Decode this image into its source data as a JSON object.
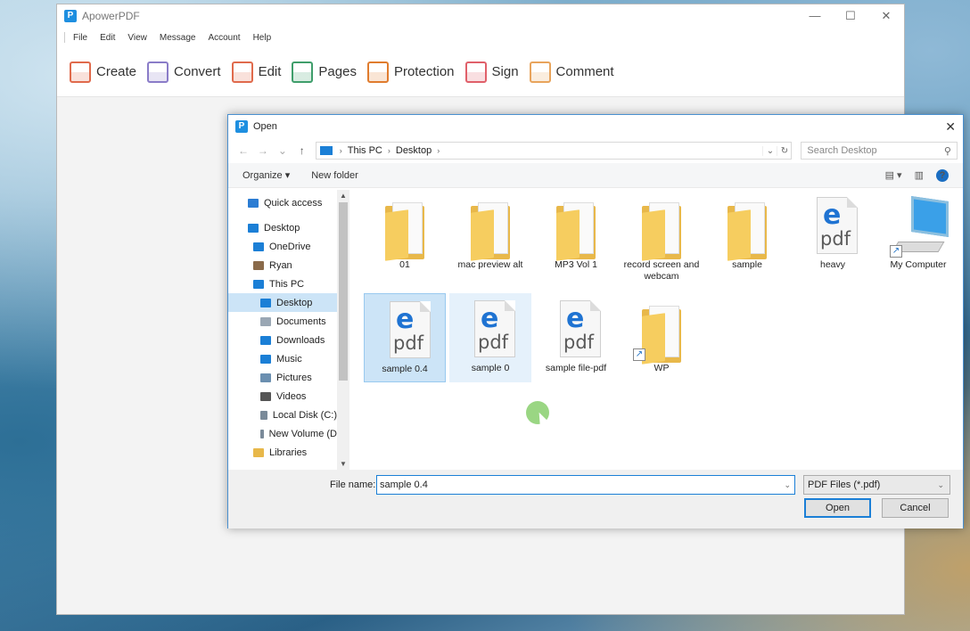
{
  "app": {
    "title": "ApowerPDF",
    "logo": "P",
    "window_controls": {
      "minimize": "—",
      "maximize": "☐",
      "close": "✕"
    },
    "menu": [
      "File",
      "Edit",
      "View",
      "Message",
      "Account",
      "Help"
    ],
    "toolbar": [
      {
        "label": "Create",
        "icon": "create-icon",
        "color": "#e06a4c"
      },
      {
        "label": "Convert",
        "icon": "convert-icon",
        "color": "#8a7cc8"
      },
      {
        "label": "Edit",
        "icon": "edit-icon",
        "color": "#e06a4c"
      },
      {
        "label": "Pages",
        "icon": "pages-icon",
        "color": "#3f9e6b"
      },
      {
        "label": "Protection",
        "icon": "shield-icon",
        "color": "#e07c2e"
      },
      {
        "label": "Sign",
        "icon": "pen-icon",
        "color": "#e0606a"
      },
      {
        "label": "Comment",
        "icon": "comment-icon",
        "color": "#e8a45c"
      }
    ]
  },
  "dialog": {
    "title": "Open",
    "close": "✕",
    "nav": {
      "back": "←",
      "forward": "→",
      "recent": "⌄",
      "up": "↑"
    },
    "breadcrumb": [
      "This PC",
      "Desktop"
    ],
    "search_placeholder": "Search Desktop",
    "organize": "Organize ▾",
    "new_folder": "New folder",
    "help": "?",
    "nav_pane": [
      {
        "label": "Quick access",
        "icon": "star-icon",
        "color": "#2b7cd3",
        "indent": 1
      },
      {
        "label": "Desktop",
        "icon": "desktop-icon",
        "color": "#1b7fd6",
        "indent": 1
      },
      {
        "label": "OneDrive",
        "icon": "cloud-icon",
        "color": "#1b7fd6",
        "indent": 2
      },
      {
        "label": "Ryan",
        "icon": "user-icon",
        "color": "#8a6a4a",
        "indent": 2
      },
      {
        "label": "This PC",
        "icon": "computer-icon",
        "color": "#1b7fd6",
        "indent": 2
      },
      {
        "label": "Desktop",
        "icon": "desktop-icon",
        "color": "#1b7fd6",
        "indent": 3,
        "selected": true
      },
      {
        "label": "Documents",
        "icon": "documents-icon",
        "color": "#9aa7b4",
        "indent": 3
      },
      {
        "label": "Downloads",
        "icon": "download-icon",
        "color": "#1b7fd6",
        "indent": 3
      },
      {
        "label": "Music",
        "icon": "music-icon",
        "color": "#1b7fd6",
        "indent": 3
      },
      {
        "label": "Pictures",
        "icon": "pictures-icon",
        "color": "#6b8fb0",
        "indent": 3
      },
      {
        "label": "Videos",
        "icon": "videos-icon",
        "color": "#555555",
        "indent": 3
      },
      {
        "label": "Local Disk (C:)",
        "icon": "disk-icon",
        "color": "#7a8a99",
        "indent": 3
      },
      {
        "label": "New Volume (D",
        "icon": "disk-icon",
        "color": "#7a8a99",
        "indent": 3
      },
      {
        "label": "Libraries",
        "icon": "libraries-icon",
        "color": "#e8b84a",
        "indent": 2
      }
    ],
    "files": [
      {
        "name": "01",
        "type": "folder"
      },
      {
        "name": "mac preview alt",
        "type": "folder"
      },
      {
        "name": "MP3 Vol 1",
        "type": "folder"
      },
      {
        "name": "record screen and webcam",
        "type": "folder"
      },
      {
        "name": "sample",
        "type": "folder"
      },
      {
        "name": "heavy",
        "type": "pdf"
      },
      {
        "name": "My Computer",
        "type": "computer"
      },
      {
        "name": "sample 0.4",
        "type": "pdf",
        "state": "selected"
      },
      {
        "name": "sample 0",
        "type": "pdf",
        "state": "hover"
      },
      {
        "name": "sample file-pdf",
        "type": "pdf"
      },
      {
        "name": "WP",
        "type": "folder-shortcut"
      }
    ],
    "pdf_icon": {
      "e": "e",
      "text": "pdf"
    },
    "file_name_label": "File name:",
    "file_name_value": "sample 0.4",
    "file_type": "PDF Files (*.pdf)",
    "open_button": "Open",
    "cancel_button": "Cancel"
  }
}
